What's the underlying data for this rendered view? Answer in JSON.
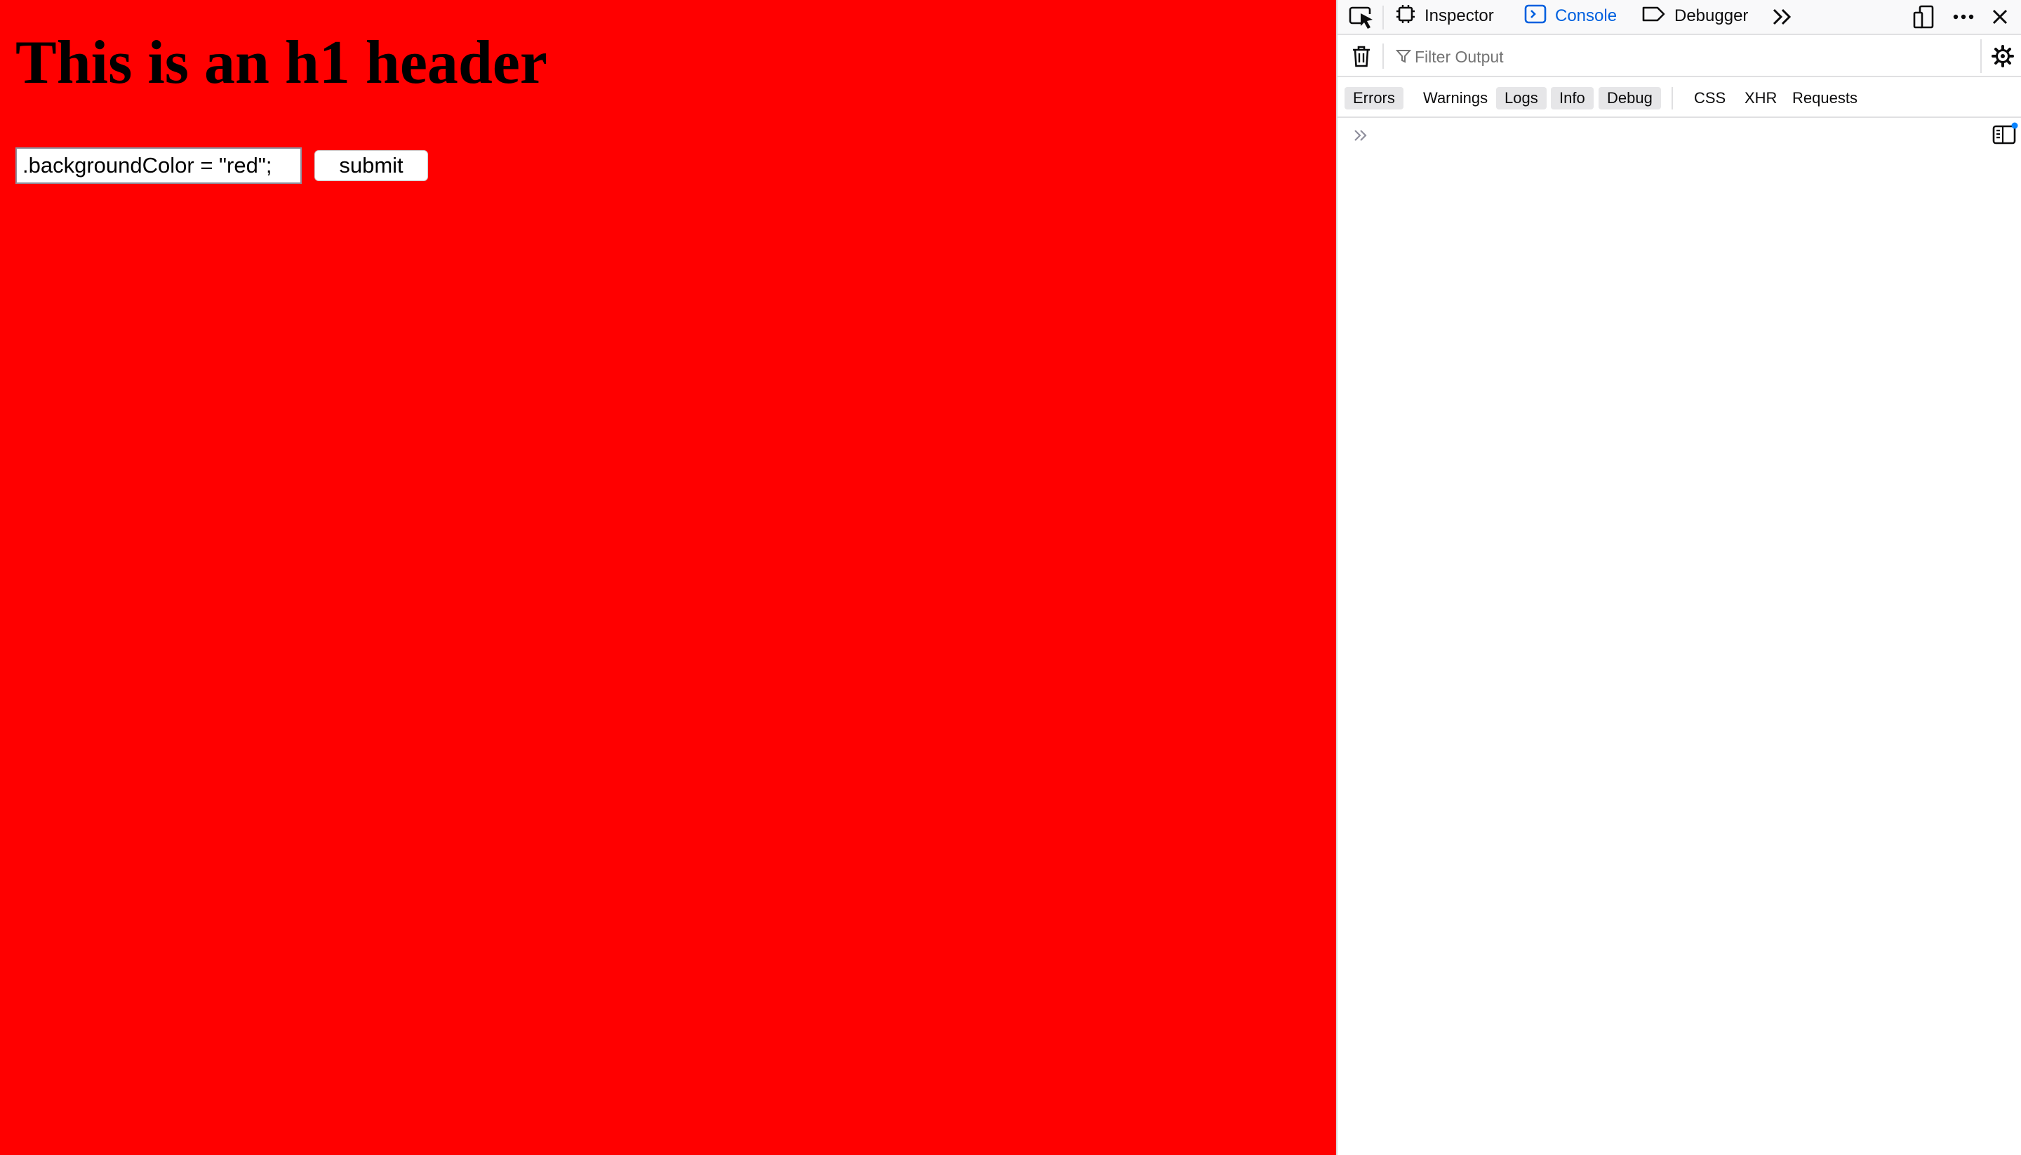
{
  "page": {
    "background_color": "#ff0000",
    "heading": "This is an h1 header",
    "input_value": ".backgroundColor = \"red\";",
    "submit_label": "submit"
  },
  "devtools": {
    "tabs": [
      {
        "label": "Inspector",
        "icon": "inspector-icon",
        "active": false
      },
      {
        "label": "Console",
        "icon": "console-icon",
        "active": true
      },
      {
        "label": "Debugger",
        "icon": "debugger-icon",
        "active": false
      }
    ],
    "accent_color": "#0060df",
    "filter_placeholder": "Filter Output",
    "levels": [
      {
        "label": "Errors",
        "active": true
      },
      {
        "label": "Warnings",
        "active": false
      },
      {
        "label": "Logs",
        "active": true
      },
      {
        "label": "Info",
        "active": true
      },
      {
        "label": "Debug",
        "active": true
      },
      {
        "label": "CSS",
        "active": false
      },
      {
        "label": "XHR",
        "active": false
      },
      {
        "label": "Requests",
        "active": false
      }
    ]
  }
}
